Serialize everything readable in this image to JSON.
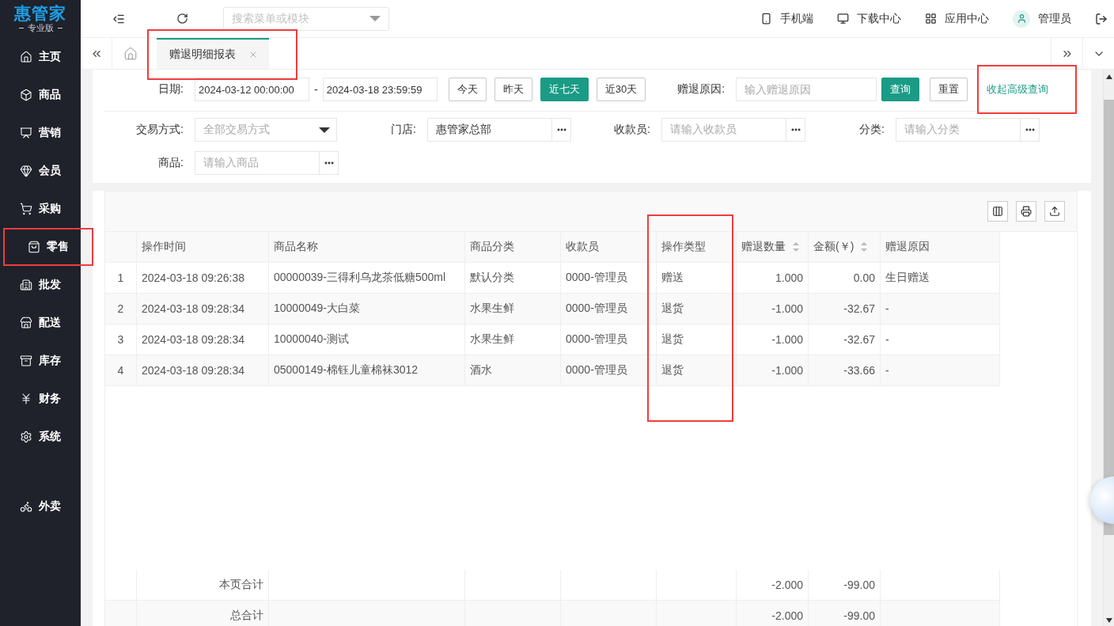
{
  "brand": {
    "name": "惠管家",
    "edition": "专业版"
  },
  "sidebar": {
    "items": [
      {
        "label": "主页",
        "highlighted": false
      },
      {
        "label": "商品",
        "highlighted": false
      },
      {
        "label": "营销",
        "highlighted": false
      },
      {
        "label": "会员",
        "highlighted": false
      },
      {
        "label": "采购",
        "highlighted": false
      },
      {
        "label": "零售",
        "highlighted": true
      },
      {
        "label": "批发",
        "highlighted": false
      },
      {
        "label": "配送",
        "highlighted": false
      },
      {
        "label": "库存",
        "highlighted": false
      },
      {
        "label": "财务",
        "highlighted": false
      },
      {
        "label": "系统",
        "highlighted": false
      }
    ],
    "extra_items": [
      {
        "label": "外卖",
        "highlighted": false
      }
    ]
  },
  "topbar": {
    "search_placeholder": "搜索菜单或模块",
    "links": [
      {
        "label": "手机端"
      },
      {
        "label": "下载中心"
      },
      {
        "label": "应用中心"
      }
    ],
    "user": "管理员"
  },
  "tabs": [
    {
      "label": "赠退明细报表",
      "selected": true,
      "highlighted": true
    }
  ],
  "filters": {
    "date": {
      "label": "日期:",
      "start": "2024-03-12 00:00:00",
      "separator": "-",
      "end": "2024-03-18 23:59:59"
    },
    "quick_ranges": [
      {
        "label": "今天",
        "selected": false
      },
      {
        "label": "昨天",
        "selected": false
      },
      {
        "label": "近七天",
        "selected": true
      },
      {
        "label": "近30天",
        "selected": false
      }
    ],
    "reason": {
      "label": "赠退原因:",
      "placeholder": "输入赠退原因"
    },
    "actions": [
      {
        "label": "查询",
        "kind": "primary"
      },
      {
        "label": "重置",
        "kind": "default"
      }
    ],
    "toggle_link": {
      "label": "收起高级查询",
      "highlighted": true
    },
    "advanced": [
      {
        "label": "交易方式:",
        "kind": "select",
        "placeholder": "全部交易方式"
      },
      {
        "label": "门店:",
        "kind": "picker",
        "value": "惠管家总部"
      },
      {
        "label": "收款员:",
        "kind": "picker",
        "placeholder": "请输入收款员"
      },
      {
        "label": "分类:",
        "kind": "picker",
        "placeholder": "请输入分类"
      },
      {
        "label": "商品:",
        "kind": "picker",
        "placeholder": "请输入商品"
      }
    ]
  },
  "table": {
    "columns": [
      {
        "sortable": false,
        "highlighted": false
      },
      {
        "label": "操作时间",
        "sortable": false,
        "highlighted": false
      },
      {
        "label": "商品名称",
        "sortable": false,
        "highlighted": false
      },
      {
        "label": "商品分类",
        "sortable": false,
        "highlighted": false
      },
      {
        "label": "收款员",
        "sortable": false,
        "highlighted": false
      },
      {
        "label": "操作类型",
        "sortable": false,
        "highlighted": true
      },
      {
        "label": "赠退数量",
        "sortable": true,
        "highlighted": false
      },
      {
        "label": "金额(￥)",
        "sortable": true,
        "highlighted": false
      },
      {
        "label": "赠退原因",
        "sortable": false,
        "highlighted": false
      }
    ],
    "rows": [
      [
        "1",
        "2024-03-18 09:26:38",
        "00000039-三得利乌龙茶低糖500ml",
        "默认分类",
        "0000-管理员",
        "赠送",
        "1.000",
        "0.00",
        "生日赠送"
      ],
      [
        "2",
        "2024-03-18 09:28:34",
        "10000049-大白菜",
        "水果生鲜",
        "0000-管理员",
        "退货",
        "-1.000",
        "-32.67",
        "-"
      ],
      [
        "3",
        "2024-03-18 09:28:34",
        "10000040-测试",
        "水果生鲜",
        "0000-管理员",
        "退货",
        "-1.000",
        "-32.67",
        "-"
      ],
      [
        "4",
        "2024-03-18 09:28:34",
        "05000149-棉钰儿童棉袜3012",
        "酒水",
        "0000-管理员",
        "退货",
        "-1.000",
        "-33.66",
        "-"
      ]
    ],
    "totals": [
      {
        "label": "本页合计",
        "quantity": "-2.000",
        "amount": "-99.00"
      },
      {
        "label": "总合计",
        "quantity": "-2.000",
        "amount": "-99.00"
      }
    ]
  }
}
